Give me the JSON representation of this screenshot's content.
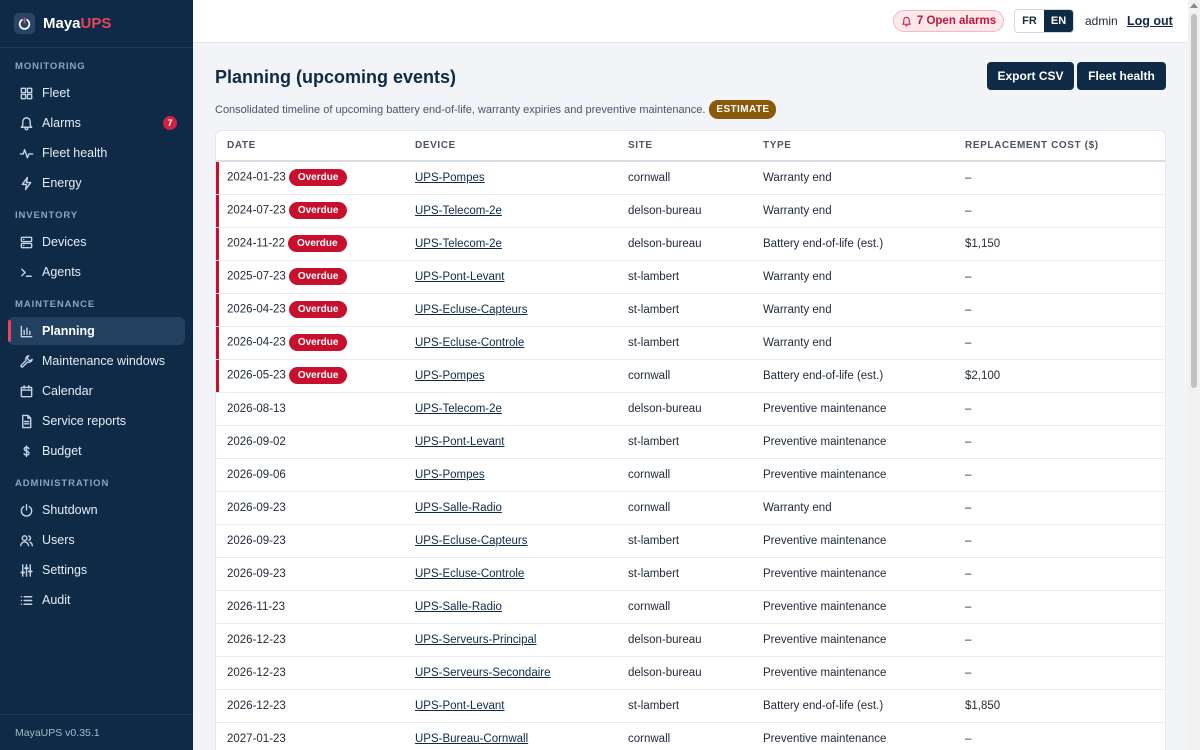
{
  "app": {
    "brand_primary": "Maya",
    "brand_accent": "UPS",
    "version": "MayaUPS v0.35.1"
  },
  "colors": {
    "navy": "#0e2a47",
    "danger": "#c8102e",
    "estimate": "#8a5a0a"
  },
  "sidebar": {
    "sections": [
      {
        "label": "MONITORING",
        "items": [
          {
            "label": "Fleet",
            "icon": "grid-icon"
          },
          {
            "label": "Alarms",
            "icon": "bell-icon",
            "badge": "7"
          },
          {
            "label": "Fleet health",
            "icon": "pulse-icon"
          },
          {
            "label": "Energy",
            "icon": "lightning-icon"
          }
        ]
      },
      {
        "label": "INVENTORY",
        "items": [
          {
            "label": "Devices",
            "icon": "server-icon"
          },
          {
            "label": "Agents",
            "icon": "terminal-icon"
          }
        ]
      },
      {
        "label": "MAINTENANCE",
        "items": [
          {
            "label": "Planning",
            "icon": "bar-chart-icon",
            "active": true
          },
          {
            "label": "Maintenance windows",
            "icon": "wrench-icon"
          },
          {
            "label": "Calendar",
            "icon": "calendar-icon"
          },
          {
            "label": "Service reports",
            "icon": "document-icon"
          },
          {
            "label": "Budget",
            "icon": "dollar-icon"
          }
        ]
      },
      {
        "label": "ADMINISTRATION",
        "items": [
          {
            "label": "Shutdown",
            "icon": "power-icon"
          },
          {
            "label": "Users",
            "icon": "users-icon"
          },
          {
            "label": "Settings",
            "icon": "sliders-icon"
          },
          {
            "label": "Audit",
            "icon": "list-icon"
          }
        ]
      }
    ]
  },
  "topbar": {
    "alarms_label": "7 Open alarms",
    "lang": [
      {
        "label": "FR",
        "active": false
      },
      {
        "label": "EN",
        "active": true
      }
    ],
    "user": "admin",
    "logout": "Log out"
  },
  "page": {
    "title": "Planning (upcoming events)",
    "subtitle": "Consolidated timeline of upcoming battery end-of-life, warranty expiries and preventive maintenance.",
    "estimate_badge": "ESTIMATE",
    "export_label": "Export CSV",
    "fleet_health_label": "Fleet health"
  },
  "table": {
    "columns": [
      "DATE",
      "DEVICE",
      "SITE",
      "TYPE",
      "REPLACEMENT COST ($)"
    ],
    "overdue_label": "Overdue",
    "rows": [
      {
        "date": "2024-01-23",
        "overdue": true,
        "device": "UPS-Pompes",
        "site": "cornwall",
        "type": "Warranty end",
        "cost": "–"
      },
      {
        "date": "2024-07-23",
        "overdue": true,
        "device": "UPS-Telecom-2e",
        "site": "delson-bureau",
        "type": "Warranty end",
        "cost": "–"
      },
      {
        "date": "2024-11-22",
        "overdue": true,
        "device": "UPS-Telecom-2e",
        "site": "delson-bureau",
        "type": "Battery end-of-life (est.)",
        "cost": "$1,150"
      },
      {
        "date": "2025-07-23",
        "overdue": true,
        "device": "UPS-Pont-Levant",
        "site": "st-lambert",
        "type": "Warranty end",
        "cost": "–"
      },
      {
        "date": "2026-04-23",
        "overdue": true,
        "device": "UPS-Ecluse-Capteurs",
        "site": "st-lambert",
        "type": "Warranty end",
        "cost": "–"
      },
      {
        "date": "2026-04-23",
        "overdue": true,
        "device": "UPS-Ecluse-Controle",
        "site": "st-lambert",
        "type": "Warranty end",
        "cost": "–"
      },
      {
        "date": "2026-05-23",
        "overdue": true,
        "device": "UPS-Pompes",
        "site": "cornwall",
        "type": "Battery end-of-life (est.)",
        "cost": "$2,100"
      },
      {
        "date": "2026-08-13",
        "overdue": false,
        "device": "UPS-Telecom-2e",
        "site": "delson-bureau",
        "type": "Preventive maintenance",
        "cost": "–"
      },
      {
        "date": "2026-09-02",
        "overdue": false,
        "device": "UPS-Pont-Levant",
        "site": "st-lambert",
        "type": "Preventive maintenance",
        "cost": "–"
      },
      {
        "date": "2026-09-06",
        "overdue": false,
        "device": "UPS-Pompes",
        "site": "cornwall",
        "type": "Preventive maintenance",
        "cost": "–"
      },
      {
        "date": "2026-09-23",
        "overdue": false,
        "device": "UPS-Salle-Radio",
        "site": "cornwall",
        "type": "Warranty end",
        "cost": "–"
      },
      {
        "date": "2026-09-23",
        "overdue": false,
        "device": "UPS-Ecluse-Capteurs",
        "site": "st-lambert",
        "type": "Preventive maintenance",
        "cost": "–"
      },
      {
        "date": "2026-09-23",
        "overdue": false,
        "device": "UPS-Ecluse-Controle",
        "site": "st-lambert",
        "type": "Preventive maintenance",
        "cost": "–"
      },
      {
        "date": "2026-11-23",
        "overdue": false,
        "device": "UPS-Salle-Radio",
        "site": "cornwall",
        "type": "Preventive maintenance",
        "cost": "–"
      },
      {
        "date": "2026-12-23",
        "overdue": false,
        "device": "UPS-Serveurs-Principal",
        "site": "delson-bureau",
        "type": "Preventive maintenance",
        "cost": "–"
      },
      {
        "date": "2026-12-23",
        "overdue": false,
        "device": "UPS-Serveurs-Secondaire",
        "site": "delson-bureau",
        "type": "Preventive maintenance",
        "cost": "–"
      },
      {
        "date": "2026-12-23",
        "overdue": false,
        "device": "UPS-Pont-Levant",
        "site": "st-lambert",
        "type": "Battery end-of-life (est.)",
        "cost": "$1,850"
      },
      {
        "date": "2027-01-23",
        "overdue": false,
        "device": "UPS-Bureau-Cornwall",
        "site": "cornwall",
        "type": "Preventive maintenance",
        "cost": "–"
      }
    ]
  }
}
